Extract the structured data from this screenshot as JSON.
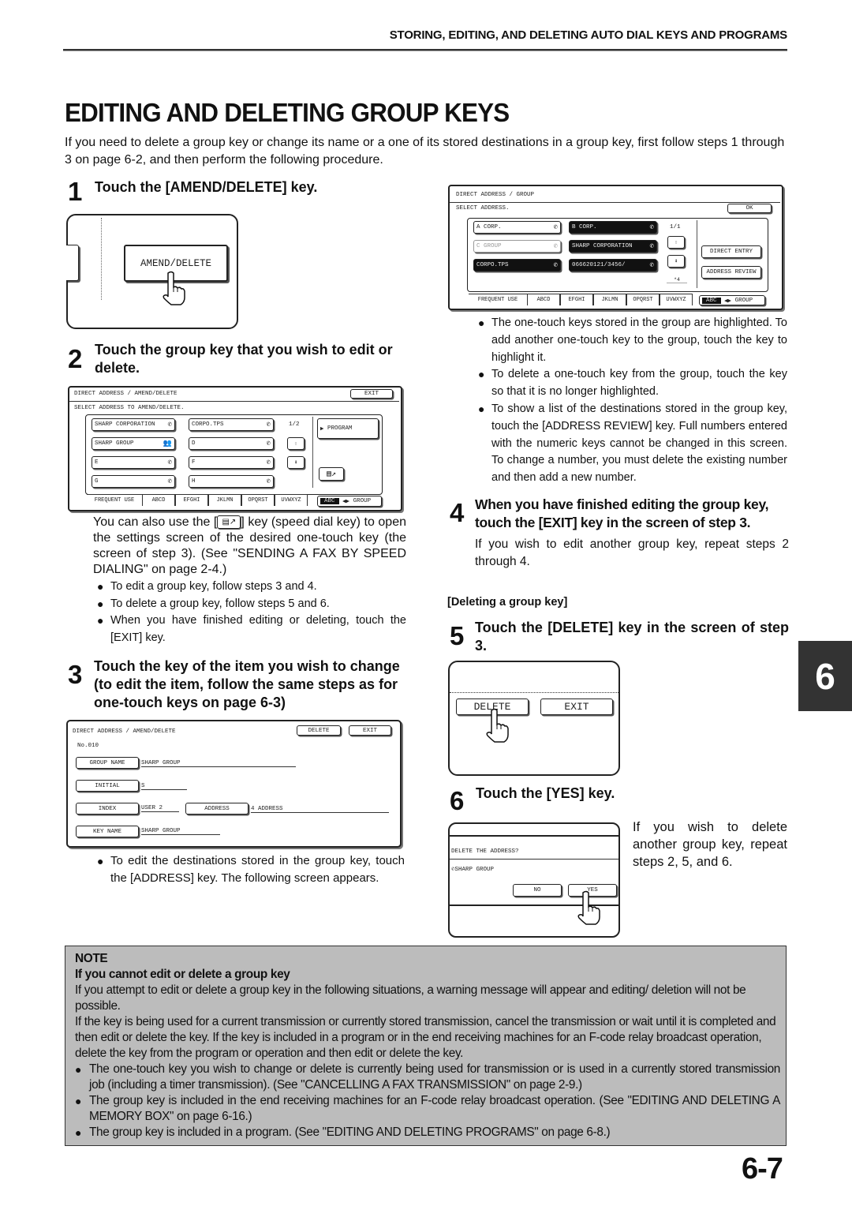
{
  "header": {
    "running_head": "STORING, EDITING, AND DELETING AUTO DIAL KEYS AND PROGRAMS",
    "title": "EDITING AND DELETING GROUP KEYS",
    "intro": "If you need to delete a group key or change its name or a one of its stored destinations in a group key, first follow steps 1 through 3 on page 6-2, and then perform the following procedure."
  },
  "steps": {
    "s1": {
      "num": "1",
      "heading": "Touch the [AMEND/DELETE] key.",
      "screen": {
        "button": "AMEND/DELETE"
      }
    },
    "s2": {
      "num": "2",
      "heading": "Touch the group key that you wish to edit or delete.",
      "screen": {
        "title": "DIRECT ADDRESS / AMEND/DELETE",
        "exit": "EXIT",
        "prompt": "SELECT ADDRESS TO AMEND/DELETE.",
        "keys": [
          {
            "label": "SHARP CORPORATION",
            "icon": "phone"
          },
          {
            "label": "CORPO.TPS",
            "icon": "phone"
          },
          {
            "label": "SHARP GROUP",
            "icon": "group"
          },
          {
            "label": "D",
            "icon": "phone"
          },
          {
            "label": "E",
            "icon": "phone"
          },
          {
            "label": "F",
            "icon": "phone"
          },
          {
            "label": "G",
            "icon": "phone"
          },
          {
            "label": "H",
            "icon": "phone"
          }
        ],
        "page": "1/2",
        "program": "PROGRAM",
        "tabs": [
          "FREQUENT USE",
          "ABCD",
          "EFGHI",
          "JKLMN",
          "OPQRST",
          "UVWXYZ"
        ],
        "toggle_left": "ABC",
        "toggle_right": "GROUP"
      },
      "note": "You can also use the [",
      "note_after": "] key (speed dial key) to open the settings screen of the desired one-touch key (the screen of step 3). (See \"SENDING A FAX BY SPEED DIALING\" on page 2-4.)",
      "bullets": [
        "To edit a group key, follow steps 3 and 4.",
        "To delete a group key, follow steps 5 and 6.",
        "When you have finished editing or deleting, touch the [EXIT] key."
      ]
    },
    "s3": {
      "num": "3",
      "heading": "Touch the key of the item you wish to change (to edit the item, follow the same steps as for one-touch keys on page 6-3)",
      "screen": {
        "title": "DIRECT ADDRESS / AMEND/DELETE",
        "delete": "DELETE",
        "exit": "EXIT",
        "number": "No.010",
        "fields": {
          "group_name_label": "GROUP NAME",
          "group_name_value": "SHARP GROUP",
          "initial_label": "INITIAL",
          "initial_value": "S",
          "index_label": "INDEX",
          "index_value": "USER 2",
          "address_label": "ADDRESS",
          "address_value": "4 ADDRESS",
          "key_name_label": "KEY NAME",
          "key_name_value": "SHARP GROUP"
        }
      },
      "bullets": [
        "To edit the destinations stored in the group key, touch the [ADDRESS] key. The following screen appears."
      ]
    },
    "group_screen": {
      "title": "DIRECT ADDRESS / GROUP",
      "prompt": "SELECT ADDRESS.",
      "ok": "OK",
      "keys": [
        {
          "label": "A CORP.",
          "state": "normal"
        },
        {
          "label": "B CORP.",
          "state": "highlighted"
        },
        {
          "label": "C GROUP",
          "state": "disabled"
        },
        {
          "label": "SHARP CORPORATION",
          "state": "highlighted"
        },
        {
          "label": "CORPO.TPS",
          "state": "highlighted"
        },
        {
          "label": "066620121/3456/",
          "state": "highlighted"
        }
      ],
      "page": "1/1",
      "count": "*4",
      "direct_entry": "DIRECT ENTRY",
      "address_review": "ADDRESS REVIEW",
      "tabs": [
        "FREQUENT USE",
        "ABCD",
        "EFGHI",
        "JKLMN",
        "OPQRST",
        "UVWXYZ"
      ],
      "toggle_left": "ABC",
      "toggle_right": "GROUP",
      "bullets": [
        "The one-touch keys stored in the group are highlighted. To add another one-touch key to the group, touch the key to highlight it.",
        "To delete a one-touch key from the group, touch the key so that it is no longer highlighted.",
        "To show a list of the destinations stored in the group key, touch the [ADDRESS REVIEW] key. Full numbers entered with the numeric keys cannot be changed in this screen. To change a number, you must delete the existing number and then add a new number."
      ]
    },
    "s4": {
      "num": "4",
      "heading": "When you have finished editing the group key, touch the [EXIT] key in the screen of step 3.",
      "body": "If you wish to edit another group key, repeat steps 2 through 4."
    },
    "deleting_label": "[Deleting a group key]",
    "s5": {
      "num": "5",
      "heading": "Touch the [DELETE] key in the screen of step 3.",
      "screen": {
        "delete": "DELETE",
        "exit": "EXIT"
      }
    },
    "s6": {
      "num": "6",
      "heading": "Touch the [YES] key.",
      "screen": {
        "question": "DELETE THE ADDRESS?",
        "item": "SHARP GROUP",
        "no": "NO",
        "yes": "YES"
      },
      "body": "If you wish to delete another group key, repeat steps 2, 5, and 6."
    }
  },
  "note": {
    "label": "NOTE",
    "heading": "If you cannot edit or delete a group key",
    "p1": "If you attempt to edit or delete a group key in the following situations, a warning message will appear and editing/ deletion will not be possible.",
    "p2": "If the key is being used for a current transmission or currently stored transmission, cancel the transmission or wait until it is completed and then edit or delete the key. If the key is included in a program or in the end receiving machines for an F-code relay broadcast operation, delete the key from the program or operation and then edit or delete the key.",
    "bullets": [
      "The one-touch key you wish to change or delete is currently being used for transmission or is used in a currently stored transmission job (including a timer transmission). (See \"CANCELLING A FAX TRANSMISSION\" on page 2-9.)",
      "The group key is included in the end receiving machines for an F-code relay broadcast operation. (See \"EDITING AND DELETING A MEMORY BOX\" on page 6-16.)",
      "The group key is included in a program. (See \"EDITING AND DELETING PROGRAMS\" on page 6-8.)"
    ]
  },
  "chapter_tab": "6",
  "page_number": "6-7"
}
